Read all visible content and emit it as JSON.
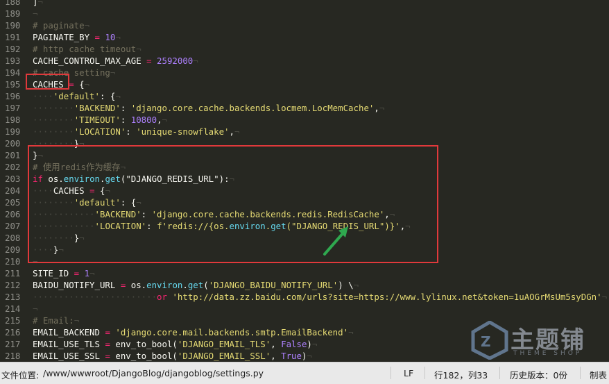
{
  "editor": {
    "lines": [
      {
        "n": "188",
        "tokens": [
          [
            "]",
            "t"
          ],
          [
            "¬",
            "ws"
          ]
        ]
      },
      {
        "n": "189",
        "tokens": [
          [
            "¬",
            "ws"
          ]
        ]
      },
      {
        "n": "190",
        "tokens": [
          [
            "# paginate",
            "cm"
          ],
          [
            "¬",
            "ws"
          ]
        ]
      },
      {
        "n": "191",
        "tokens": [
          [
            "PAGINATE_BY",
            "t"
          ],
          [
            " = ",
            "kw"
          ],
          [
            "10",
            "num"
          ],
          [
            "¬",
            "ws"
          ]
        ]
      },
      {
        "n": "192",
        "tokens": [
          [
            "# http cache timeout",
            "cm"
          ],
          [
            "¬",
            "ws"
          ]
        ]
      },
      {
        "n": "193",
        "tokens": [
          [
            "CACHE_CONTROL_MAX_AGE",
            "t"
          ],
          [
            " = ",
            "kw"
          ],
          [
            "2592000",
            "num"
          ],
          [
            "¬",
            "ws"
          ]
        ]
      },
      {
        "n": "194",
        "tokens": [
          [
            "# cache setting",
            "cm"
          ],
          [
            "¬",
            "ws"
          ]
        ]
      },
      {
        "n": "195",
        "tokens": [
          [
            "CACHES",
            "t"
          ],
          [
            " = ",
            "kw"
          ],
          [
            "{",
            "t"
          ],
          [
            "¬",
            "ws"
          ]
        ]
      },
      {
        "n": "196",
        "tokens": [
          [
            "····",
            "ws"
          ],
          [
            "'default'",
            "str"
          ],
          [
            ": {",
            "t"
          ],
          [
            "¬",
            "ws"
          ]
        ]
      },
      {
        "n": "197",
        "tokens": [
          [
            "········",
            "ws"
          ],
          [
            "'BACKEND'",
            "str"
          ],
          [
            ": ",
            "t"
          ],
          [
            "'django.core.cache.backends.locmem.LocMemCache'",
            "str"
          ],
          [
            ",",
            "t"
          ],
          [
            "¬",
            "ws"
          ]
        ]
      },
      {
        "n": "198",
        "tokens": [
          [
            "········",
            "ws"
          ],
          [
            "'TIMEOUT'",
            "str"
          ],
          [
            ": ",
            "t"
          ],
          [
            "10800",
            "num"
          ],
          [
            ",",
            "t"
          ],
          [
            "¬",
            "ws"
          ]
        ]
      },
      {
        "n": "199",
        "tokens": [
          [
            "········",
            "ws"
          ],
          [
            "'LOCATION'",
            "str"
          ],
          [
            ": ",
            "t"
          ],
          [
            "'unique-snowflake'",
            "str"
          ],
          [
            ",",
            "t"
          ],
          [
            "¬",
            "ws"
          ]
        ]
      },
      {
        "n": "200",
        "tokens": [
          [
            "········",
            "ws"
          ],
          [
            "}",
            "t"
          ],
          [
            "¬",
            "ws"
          ]
        ]
      },
      {
        "n": "201",
        "tokens": [
          [
            "}",
            "t"
          ],
          [
            "¬",
            "ws"
          ]
        ]
      },
      {
        "n": "202",
        "tokens": [
          [
            "# 使用redis作为缓存",
            "cm"
          ],
          [
            "¬",
            "ws"
          ]
        ]
      },
      {
        "n": "203",
        "tokens": [
          [
            "if ",
            "kw"
          ],
          [
            "os.",
            "t"
          ],
          [
            "environ",
            "fn"
          ],
          [
            ".",
            "t"
          ],
          [
            "get",
            "fn"
          ],
          [
            "(\"DJANGO_REDIS_URL\")",
            "t"
          ],
          [
            ":",
            "t"
          ],
          [
            "¬",
            "ws"
          ]
        ]
      },
      {
        "n": "204",
        "tokens": [
          [
            "····",
            "ws"
          ],
          [
            "CACHES",
            "t"
          ],
          [
            " = ",
            "kw"
          ],
          [
            "{",
            "t"
          ],
          [
            "¬",
            "ws"
          ]
        ]
      },
      {
        "n": "205",
        "tokens": [
          [
            "········",
            "ws"
          ],
          [
            "'default'",
            "str"
          ],
          [
            ": {",
            "t"
          ],
          [
            "¬",
            "ws"
          ]
        ]
      },
      {
        "n": "206",
        "tokens": [
          [
            "············",
            "ws"
          ],
          [
            "'BACKEND'",
            "str"
          ],
          [
            ": ",
            "t"
          ],
          [
            "'django.core.cache.backends.redis.RedisCache'",
            "str"
          ],
          [
            ",",
            "t"
          ],
          [
            "¬",
            "ws"
          ]
        ]
      },
      {
        "n": "207",
        "tokens": [
          [
            "············",
            "ws"
          ],
          [
            "'LOCATION'",
            "str"
          ],
          [
            ": ",
            "t"
          ],
          [
            "f'redis://{os.",
            "str"
          ],
          [
            "environ",
            "fn"
          ],
          [
            ".",
            "str"
          ],
          [
            "get",
            "fn"
          ],
          [
            "(\"DJANGO_REDIS_URL\")}'",
            "str"
          ],
          [
            ",",
            "t"
          ],
          [
            "¬",
            "ws"
          ]
        ]
      },
      {
        "n": "208",
        "tokens": [
          [
            "········",
            "ws"
          ],
          [
            "}",
            "t"
          ],
          [
            "¬",
            "ws"
          ]
        ]
      },
      {
        "n": "209",
        "tokens": [
          [
            "····",
            "ws"
          ],
          [
            "}",
            "t"
          ],
          [
            "¬",
            "ws"
          ]
        ]
      },
      {
        "n": "210",
        "tokens": [
          [
            "¬",
            "ws"
          ]
        ]
      },
      {
        "n": "211",
        "tokens": [
          [
            "SITE_ID",
            "t"
          ],
          [
            " = ",
            "kw"
          ],
          [
            "1",
            "num"
          ],
          [
            "¬",
            "ws"
          ]
        ]
      },
      {
        "n": "212",
        "tokens": [
          [
            "BAIDU_NOTIFY_URL",
            "t"
          ],
          [
            " = ",
            "kw"
          ],
          [
            "os.",
            "t"
          ],
          [
            "environ",
            "fn"
          ],
          [
            ".",
            "t"
          ],
          [
            "get",
            "fn"
          ],
          [
            "(",
            "t"
          ],
          [
            "'DJANGO_BAIDU_NOTIFY_URL'",
            "str"
          ],
          [
            ") \\",
            "t"
          ],
          [
            "¬",
            "ws"
          ]
        ]
      },
      {
        "n": "213",
        "tokens": [
          [
            "························",
            "ws"
          ],
          [
            "or ",
            "kw"
          ],
          [
            "'http://data.zz.baidu.com/urls?site=https://www.lylinux.net&token=1uAOGrMsUm5syDGn'",
            "str"
          ],
          [
            "¬",
            "ws"
          ]
        ]
      },
      {
        "n": "214",
        "tokens": [
          [
            "¬",
            "ws"
          ]
        ]
      },
      {
        "n": "215",
        "tokens": [
          [
            "# Email:",
            "cm"
          ],
          [
            "¬",
            "ws"
          ]
        ]
      },
      {
        "n": "216",
        "tokens": [
          [
            "EMAIL_BACKEND",
            "t"
          ],
          [
            " = ",
            "kw"
          ],
          [
            "'django.core.mail.backends.smtp.EmailBackend'",
            "str"
          ],
          [
            "¬",
            "ws"
          ]
        ]
      },
      {
        "n": "217",
        "tokens": [
          [
            "EMAIL_USE_TLS",
            "t"
          ],
          [
            " = ",
            "kw"
          ],
          [
            "env_to_bool(",
            "t"
          ],
          [
            "'DJANGO_EMAIL_TLS'",
            "str"
          ],
          [
            ", ",
            "t"
          ],
          [
            "False",
            "num"
          ],
          [
            ")",
            "t"
          ],
          [
            "¬",
            "ws"
          ]
        ]
      },
      {
        "n": "218",
        "tokens": [
          [
            "EMAIL_USE_SSL",
            "t"
          ],
          [
            " = ",
            "kw"
          ],
          [
            "env_to_bool(",
            "t"
          ],
          [
            "'DJANGO_EMAIL_SSL'",
            "str"
          ],
          [
            ", ",
            "t"
          ],
          [
            "True",
            "num"
          ],
          [
            ")",
            "t"
          ],
          [
            "¬",
            "ws"
          ]
        ]
      }
    ]
  },
  "watermark": {
    "brand": "主题铺",
    "sub": "THEME SHOP"
  },
  "statusbar": {
    "path_label": "文件位置:",
    "path": "/www/wwwroot/DjangoBlog/djangoblog/settings.py",
    "line_ending": "LF",
    "position": "行182，列33",
    "history": "历史版本：0份",
    "tab": "制表"
  }
}
